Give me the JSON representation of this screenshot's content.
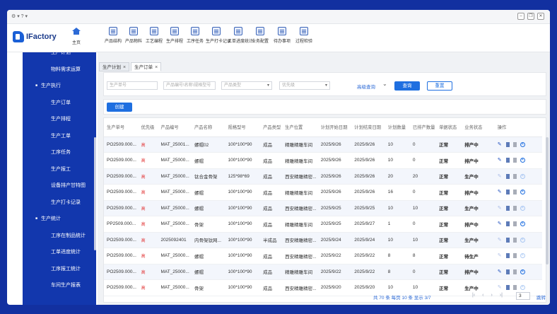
{
  "titlebar": {
    "left_icons": "⚙ ▾   ? ▾"
  },
  "app": {
    "logo_text": "IFactory"
  },
  "home": {
    "label": "主页"
  },
  "toolbar": [
    "产品结构",
    "产品物料",
    "工艺编程",
    "生产排程",
    "工序任务",
    "生产打卡记录",
    "工单进度统计",
    "业务配置",
    "待办事项",
    "过程检验"
  ],
  "sidebar": {
    "items": [
      {
        "label": "生产计划",
        "group": false
      },
      {
        "label": "物料需求运算",
        "group": false
      },
      {
        "label": "生产执行",
        "group": true
      },
      {
        "label": "生产订单",
        "group": false
      },
      {
        "label": "生产排程",
        "group": false
      },
      {
        "label": "生产工单",
        "group": false
      },
      {
        "label": "工序任务",
        "group": false
      },
      {
        "label": "生产报工",
        "group": false
      },
      {
        "label": "设备排产甘特图",
        "group": false
      },
      {
        "label": "生产打卡记录",
        "group": false
      },
      {
        "label": "生产统计",
        "group": true
      },
      {
        "label": "工序在制品统计",
        "group": false
      },
      {
        "label": "工单进度统计",
        "group": false
      },
      {
        "label": "工序报工统计",
        "group": false
      },
      {
        "label": "车间生产报表",
        "group": false
      }
    ]
  },
  "tabs": [
    {
      "label": "生产计划"
    },
    {
      "label": "生产订单"
    }
  ],
  "filters": {
    "order_no": "生产单号",
    "product": "产品编号\\名称\\规格型号",
    "product_type": "产品类型",
    "priority": "优先级",
    "advanced": "高级查询",
    "search": "查询",
    "reset": "重置"
  },
  "create_label": "创建",
  "table": {
    "headers": [
      "生产单号",
      "优先级",
      "产品编号",
      "产品名称",
      "规格型号",
      "产品类型",
      "生产位置",
      "计划开始日期",
      "计划结束日期",
      "计划数量",
      "已排产数量",
      "单据状态",
      "业务状态",
      "操作"
    ],
    "rows": [
      [
        "PO2509.000...",
        "高",
        "MAT_25001...",
        "螺帽02",
        "100*100*90",
        "成品",
        "精雕精雕车间",
        "2025/9/26",
        "2025/9/26",
        "10",
        "0",
        "正常",
        "排产中"
      ],
      [
        "PO2509.000...",
        "高",
        "MAT_25000...",
        "螺帽",
        "100*100*90",
        "成品",
        "精雕精雕车间",
        "2025/9/26",
        "2025/9/26",
        "10",
        "0",
        "正常",
        "排产中"
      ],
      [
        "PO2509.000...",
        "高",
        "MAT_25000...",
        "钛合金骨架",
        "125*98*69",
        "成品",
        "西安精雕精密...",
        "2025/9/26",
        "2025/9/26",
        "20",
        "20",
        "正常",
        "生产中"
      ],
      [
        "PO2509.000...",
        "高",
        "MAT_25000...",
        "螺帽",
        "100*100*90",
        "成品",
        "精雕精雕车间",
        "2025/9/26",
        "2025/9/26",
        "16",
        "0",
        "正常",
        "排产中"
      ],
      [
        "PO2509.000...",
        "高",
        "MAT_25000...",
        "螺帽",
        "100*100*90",
        "成品",
        "西安精雕精密...",
        "2025/9/25",
        "2025/9/25",
        "10",
        "10",
        "正常",
        "生产中"
      ],
      [
        "PP2509.000...",
        "高",
        "MAT_25000...",
        "骨架",
        "100*100*90",
        "成品",
        "精雕精雕车间",
        "2025/9/25",
        "2025/9/27",
        "1",
        "0",
        "正常",
        "排产中"
      ],
      [
        "PO2509.000...",
        "高",
        "2025092401",
        "内骨架钛网...",
        "100*100*90",
        "半成品",
        "西安精雕精密...",
        "2025/9/24",
        "2025/9/24",
        "10",
        "10",
        "正常",
        "生产中"
      ],
      [
        "PO2509.000...",
        "高",
        "MAT_25000...",
        "螺帽",
        "100*100*90",
        "成品",
        "西安精雕精密...",
        "2025/9/22",
        "2025/9/22",
        "8",
        "8",
        "正常",
        "待生产"
      ],
      [
        "PO2509.000...",
        "高",
        "MAT_25000...",
        "螺帽",
        "100*100*90",
        "成品",
        "精雕精雕车间",
        "2025/9/22",
        "2025/9/22",
        "8",
        "0",
        "正常",
        "排产中"
      ],
      [
        "PO2509.000...",
        "高",
        "MAT_25000...",
        "骨架",
        "100*100*90",
        "成品",
        "西安精雕精密...",
        "2025/9/20",
        "2025/9/20",
        "10",
        "10",
        "正常",
        "生产中"
      ]
    ]
  },
  "pager": {
    "summary": "共 70 条  每页 10 条  显示 3/7",
    "page": "3",
    "jump": "跳转"
  }
}
